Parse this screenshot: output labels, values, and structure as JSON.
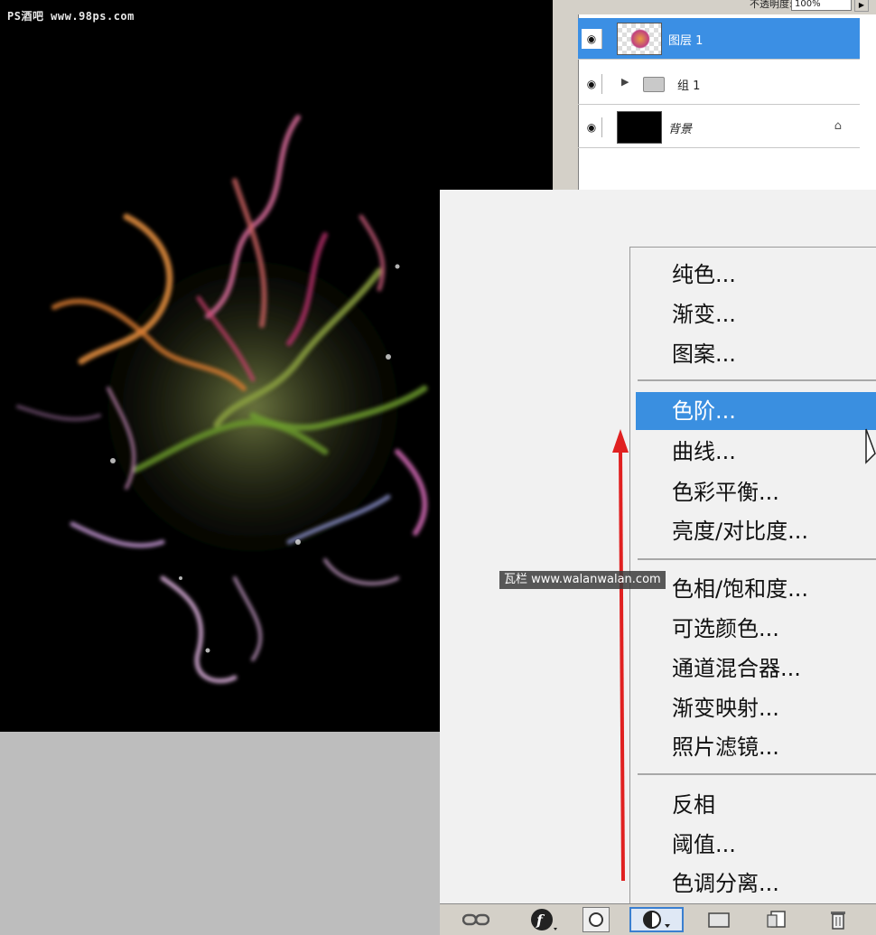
{
  "canvas": {
    "watermark": "PS酒吧 www.98ps.com"
  },
  "layers_panel": {
    "opacity_label": "不透明度:",
    "opacity_value": "100%",
    "layers": [
      {
        "name": "图层 1",
        "selected": true,
        "type": "layer"
      },
      {
        "name": "组 1",
        "selected": false,
        "type": "group"
      },
      {
        "name": "背景",
        "selected": false,
        "type": "background",
        "locked": true
      }
    ]
  },
  "adjustment_menu": {
    "groups": [
      [
        "纯色...",
        "渐变...",
        "图案..."
      ],
      [
        "色阶...",
        "曲线...",
        "色彩平衡...",
        "亮度/对比度..."
      ],
      [
        "色相/饱和度...",
        "可选颜色...",
        "通道混合器...",
        "渐变映射...",
        "照片滤镜..."
      ],
      [
        "反相",
        "阈值...",
        "色调分离..."
      ]
    ],
    "highlighted": "色阶..."
  },
  "watermark_banner": "瓦栏 www.walanwalan.com",
  "toolbar": {
    "buttons": [
      "link-icon",
      "fx-icon",
      "mask-icon",
      "adjustment-layer-icon",
      "group-icon",
      "new-layer-icon",
      "trash-icon"
    ]
  },
  "colors": {
    "selection": "#3a8fe0",
    "arrow": "#e02020",
    "canvas": "#000000"
  }
}
